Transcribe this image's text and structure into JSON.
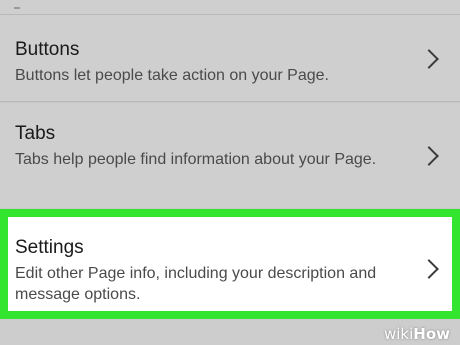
{
  "settings_list": {
    "items": [
      {
        "title": "Buttons",
        "description": "Buttons let people take action on your Page."
      },
      {
        "title": "Tabs",
        "description": "Tabs help people find information about your Page."
      },
      {
        "title": "Settings",
        "description": "Edit other Page info, including your description and message options.",
        "highlighted": true
      }
    ],
    "highlight_color": "#34e52f"
  },
  "watermark": {
    "prefix": "wiki",
    "suffix": "How"
  }
}
